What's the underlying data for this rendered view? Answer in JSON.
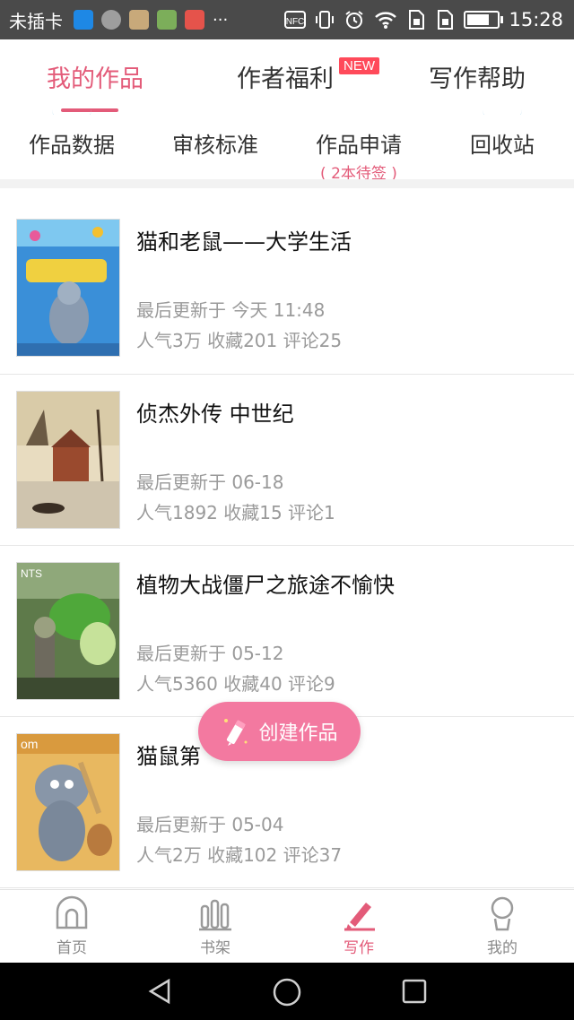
{
  "status_bar": {
    "carrier": "未插卡",
    "more": "···",
    "time": "15:28",
    "icons": [
      "video-app-icon",
      "chat-app-icon",
      "gallery-app-icon",
      "photo-app-icon",
      "music-app-icon",
      "nfc-icon",
      "vibrate-icon",
      "alarm-icon",
      "wifi-icon",
      "sim-icon",
      "sim2-icon",
      "battery-icon"
    ]
  },
  "tabs": {
    "my_works": "我的作品",
    "author_benefits": "作者福利",
    "new_badge": "NEW",
    "writing_help": "写作帮助"
  },
  "submenu": {
    "work_data": "作品数据",
    "review_standard": "审核标准",
    "work_apply": "作品申请",
    "work_apply_note": "( 2本待签 )",
    "recycle_bin": "回收站"
  },
  "books": [
    {
      "title": "猫和老鼠——大学生活",
      "updated": "最后更新于 今天 11:48",
      "stats": "人气3万 收藏201 评论25",
      "cover": "tom-jerry-college-cover"
    },
    {
      "title": "侦杰外传  中世纪",
      "updated": "最后更新于 06-18",
      "stats": "人气1892 收藏15 评论1",
      "cover": "winter-village-painting-cover"
    },
    {
      "title": "植物大战僵尸之旅途不愉快",
      "updated": "最后更新于 05-12",
      "stats": "人气5360 收藏40 评论9",
      "cover": "plants-vs-zombies-cover"
    },
    {
      "title": "猫鼠第",
      "updated": "最后更新于 05-04",
      "stats": "人气2万 收藏102 评论37",
      "cover": "tom-jerry-cover"
    }
  ],
  "fab": {
    "label": "创建作品",
    "icon": "pencil-icon"
  },
  "bottom_nav": [
    {
      "label": "首页",
      "icon": "home-icon"
    },
    {
      "label": "书架",
      "icon": "bookshelf-icon"
    },
    {
      "label": "写作",
      "icon": "write-icon"
    },
    {
      "label": "我的",
      "icon": "profile-icon"
    }
  ],
  "system_nav": [
    "back-icon",
    "home-circle-icon",
    "recents-icon"
  ],
  "colors": {
    "accent": "#e35b79",
    "fab": "#f379a0",
    "new_badge": "#ff4a5a",
    "statusbar": "#4a4a4a"
  }
}
